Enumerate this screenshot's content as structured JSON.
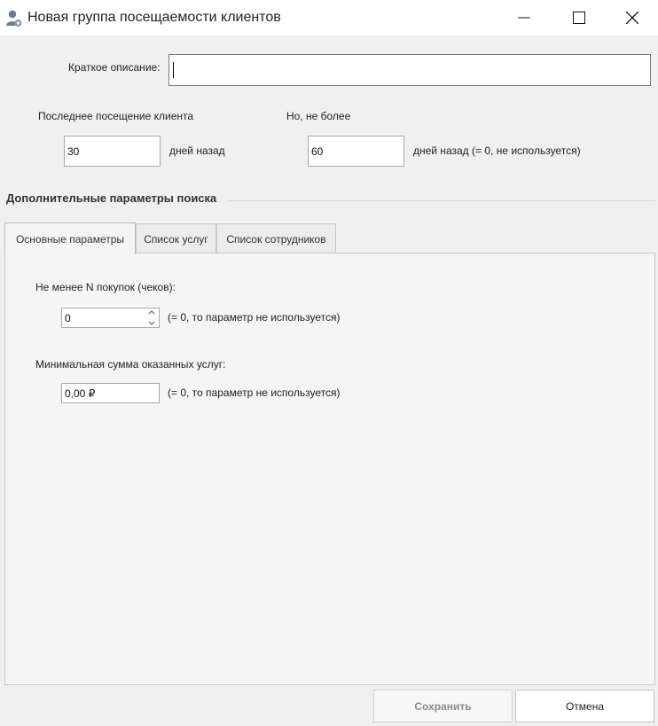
{
  "window": {
    "title": "Новая группа посещаемости клиентов",
    "icon": "user-group-icon",
    "controls": [
      "minimize-icon",
      "maximize-icon",
      "close-icon"
    ]
  },
  "form": {
    "description_label": "Краткое описание:",
    "description_value": "",
    "last_visit_label": "Последнее посещение клиента",
    "last_visit_value": "30",
    "last_visit_suffix": "дней назад",
    "not_more_label": "Но, не более",
    "not_more_value": "60",
    "not_more_suffix": "дней назад (= 0, не используется)"
  },
  "section": {
    "title": "Дополнительные параметры поиска"
  },
  "tabs": [
    {
      "label": "Основные параметры",
      "active": true
    },
    {
      "label": "Список услуг",
      "active": false
    },
    {
      "label": "Список сотрудников",
      "active": false
    }
  ],
  "main_tab": {
    "min_purchases_label": "Не менее N покупок (чеков):",
    "min_purchases_value": "0",
    "min_purchases_hint": "(= 0, то параметр не используется)",
    "min_sum_label": "Минимальная сумма оказанных услуг:",
    "min_sum_value": "0,00 ₽",
    "min_sum_hint": "(= 0, то параметр не используется)"
  },
  "buttons": {
    "save": "Сохранить",
    "cancel": "Отмена"
  }
}
